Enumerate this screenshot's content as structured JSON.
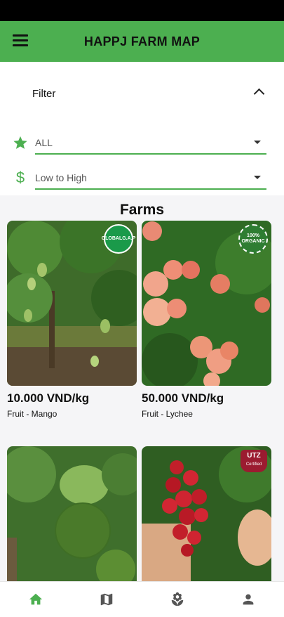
{
  "app": {
    "title": "HAPPJ FARM MAP"
  },
  "filter": {
    "label": "Filter",
    "rating_select": {
      "value": "ALL",
      "icon": "star-icon"
    },
    "price_select": {
      "value": "Low to High",
      "icon": "dollar-icon"
    }
  },
  "farms": {
    "title": "Farms",
    "items": [
      {
        "price": "10.000 VND/kg",
        "category": "Fruit - Mango",
        "badge": "GLOBALG.A.P",
        "fruit": "mango"
      },
      {
        "price": "50.000 VND/kg",
        "category": "Fruit - Lychee",
        "badge": "100% ORGANIC",
        "fruit": "lychee"
      },
      {
        "price": "",
        "category": "",
        "badge": "",
        "fruit": "orange"
      },
      {
        "price": "",
        "category": "",
        "badge": "UTZ",
        "badge_sub": "Certified",
        "fruit": "rambutan"
      }
    ]
  },
  "bottom_nav": [
    {
      "name": "home",
      "icon": "home-icon",
      "active": true
    },
    {
      "name": "map",
      "icon": "map-icon",
      "active": false
    },
    {
      "name": "farm",
      "icon": "plant-icon",
      "active": false
    },
    {
      "name": "profile",
      "icon": "person-icon",
      "active": false
    }
  ],
  "colors": {
    "primary": "#4caf50",
    "nav_active": "#4caf50",
    "nav_inactive": "#555555"
  }
}
